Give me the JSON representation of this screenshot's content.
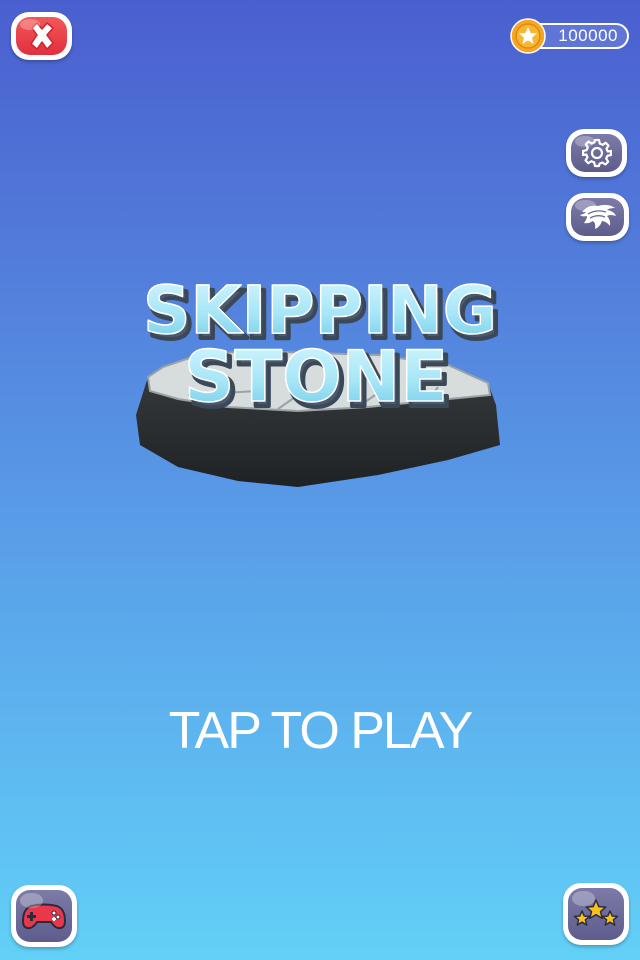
{
  "coins": {
    "value": "100000"
  },
  "logo": {
    "line1": "SKIPPING",
    "line2": "STONE"
  },
  "prompt": {
    "tap_label": "TAP TO PLAY"
  },
  "buttons": {
    "close": "close-icon",
    "settings": "gear-icon",
    "skin": "hair-icon",
    "more_games": "gamepad-icon",
    "rate": "stars-icon"
  },
  "colors": {
    "background_top": "#4a5fcf",
    "background_bottom": "#62d0f7",
    "close_button": "#e8384a",
    "menu_button": "#6a6998",
    "coin": "#f5a623",
    "stone": "#2a2e30",
    "logo_text": "#a6e6f7"
  }
}
